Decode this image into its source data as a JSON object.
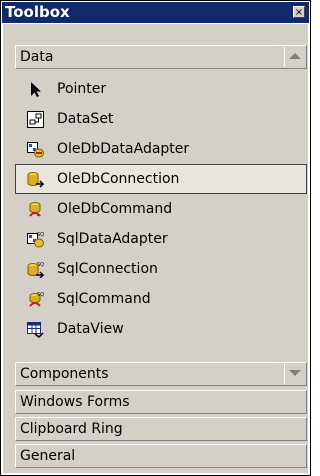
{
  "window": {
    "title": "Toolbox",
    "close_glyph": "×"
  },
  "tabs": {
    "data": "Data",
    "components": "Components",
    "windows_forms": "Windows Forms",
    "clipboard_ring": "Clipboard Ring",
    "general": "General"
  },
  "items": [
    {
      "label": "Pointer",
      "icon": "pointer-icon"
    },
    {
      "label": "DataSet",
      "icon": "dataset-icon"
    },
    {
      "label": "OleDbDataAdapter",
      "icon": "oledb-data-adapter-icon"
    },
    {
      "label": "OleDbConnection",
      "icon": "oledb-connection-icon",
      "selected": true
    },
    {
      "label": "OleDbCommand",
      "icon": "oledb-command-icon"
    },
    {
      "label": "SqlDataAdapter",
      "icon": "sql-data-adapter-icon"
    },
    {
      "label": "SqlConnection",
      "icon": "sql-connection-icon"
    },
    {
      "label": "SqlCommand",
      "icon": "sql-command-icon"
    },
    {
      "label": "DataView",
      "icon": "dataview-icon"
    }
  ],
  "colors": {
    "titlebar": "#102a6c",
    "panel": "#d4d0c8",
    "selected": "#e8e5dd"
  }
}
